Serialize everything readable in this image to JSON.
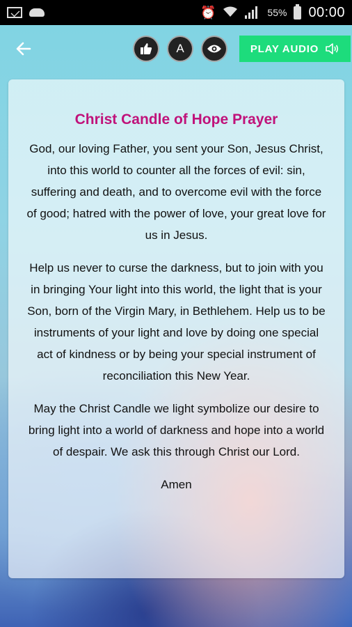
{
  "status_bar": {
    "battery_percent": "55%",
    "time": "00:00",
    "icons": [
      "mail-icon",
      "cloud-icon",
      "alarm-icon",
      "wifi-icon",
      "signal-icon",
      "battery-icon"
    ]
  },
  "app_bar": {
    "back_icon": "arrow-left-icon",
    "like_icon": "thumbs-up-icon",
    "font_button_label": "A",
    "eye_icon": "eye-icon",
    "play_audio_label": "PLAY AUDIO",
    "play_audio_icon": "speaker-icon",
    "play_audio_color": "#1ddc7c"
  },
  "prayer": {
    "title": "Christ Candle of Hope Prayer",
    "title_color": "#c0127a",
    "paragraphs": [
      "God, our loving Father, you sent your Son, Jesus Christ, into this world to counter all the forces of evil: sin, suffering and death, and to overcome evil with the force of good; hatred with the power of love, your great love for us in Jesus.",
      "Help us never to curse the darkness, but to join with you in bringing Your light into this world, the light that is your Son, born of the Virgin Mary, in Bethlehem. Help us to be instruments of your light and love by doing one special act of kindness or by being your special instrument of reconciliation this New Year.",
      "May the Christ Candle we light symbolize our desire to bring light into a world of darkness and hope into a world of despair. We ask this through Christ our Lord."
    ],
    "closing": "Amen"
  }
}
